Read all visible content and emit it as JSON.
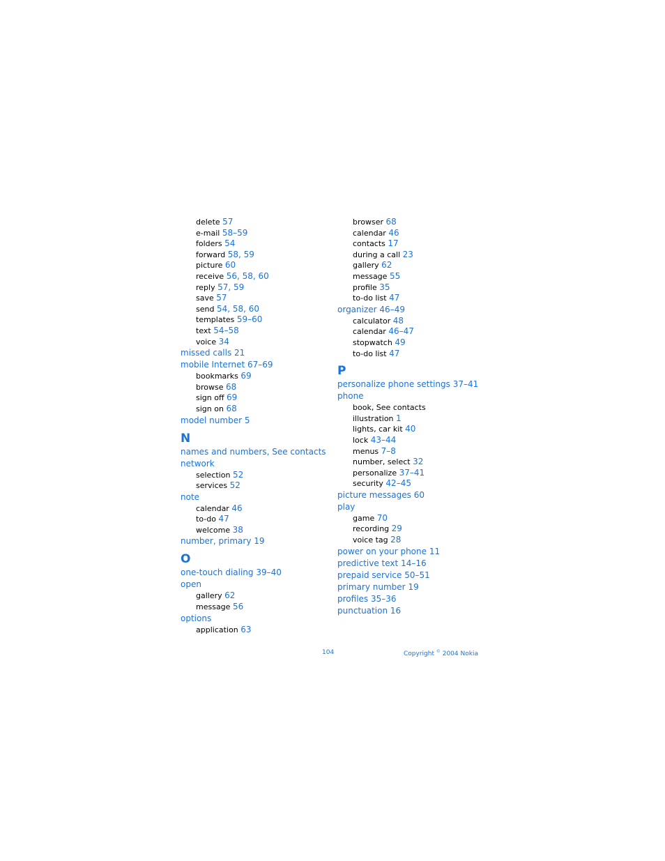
{
  "left_column": [
    {
      "type": "sub",
      "term": "delete",
      "pages": "57"
    },
    {
      "type": "sub",
      "term": "e-mail",
      "pages": "58–59"
    },
    {
      "type": "sub",
      "term": "folders",
      "pages": "54"
    },
    {
      "type": "sub",
      "term": "forward",
      "pages": "58, 59"
    },
    {
      "type": "sub",
      "term": "picture",
      "pages": "60"
    },
    {
      "type": "sub",
      "term": "receive",
      "pages": "56, 58, 60"
    },
    {
      "type": "sub",
      "term": "reply",
      "pages": "57, 59"
    },
    {
      "type": "sub",
      "term": "save",
      "pages": "57"
    },
    {
      "type": "sub",
      "term": "send",
      "pages": "54, 58, 60"
    },
    {
      "type": "sub",
      "term": "templates",
      "pages": "59–60"
    },
    {
      "type": "sub",
      "term": "text",
      "pages": "54–58"
    },
    {
      "type": "sub",
      "term": "voice",
      "pages": "34"
    },
    {
      "type": "main",
      "term": "missed calls",
      "pages": "21"
    },
    {
      "type": "main",
      "term": "mobile Internet",
      "pages": "67–69"
    },
    {
      "type": "sub",
      "term": "bookmarks",
      "pages": "69"
    },
    {
      "type": "sub",
      "term": "browse",
      "pages": "68"
    },
    {
      "type": "sub",
      "term": "sign off",
      "pages": "69"
    },
    {
      "type": "sub",
      "term": "sign on",
      "pages": "68"
    },
    {
      "type": "main",
      "term": "model number",
      "pages": "5"
    },
    {
      "type": "letter",
      "term": "N"
    },
    {
      "type": "main",
      "term": "names and numbers, See contacts",
      "pages": ""
    },
    {
      "type": "main",
      "term": "network",
      "pages": ""
    },
    {
      "type": "sub",
      "term": "selection",
      "pages": "52"
    },
    {
      "type": "sub",
      "term": "services",
      "pages": "52"
    },
    {
      "type": "main",
      "term": "note",
      "pages": ""
    },
    {
      "type": "sub",
      "term": "calendar",
      "pages": "46"
    },
    {
      "type": "sub",
      "term": "to-do",
      "pages": "47"
    },
    {
      "type": "sub",
      "term": "welcome",
      "pages": "38"
    },
    {
      "type": "main",
      "term": "number, primary",
      "pages": "19"
    },
    {
      "type": "letter",
      "term": "O"
    },
    {
      "type": "main",
      "term": "one-touch dialing",
      "pages": "39–40"
    },
    {
      "type": "main",
      "term": "open",
      "pages": ""
    },
    {
      "type": "sub",
      "term": "gallery",
      "pages": "62"
    },
    {
      "type": "sub",
      "term": "message",
      "pages": "56"
    },
    {
      "type": "main",
      "term": "options",
      "pages": ""
    },
    {
      "type": "sub",
      "term": "application",
      "pages": "63"
    }
  ],
  "right_column": [
    {
      "type": "sub",
      "term": "browser",
      "pages": "68"
    },
    {
      "type": "sub",
      "term": "calendar",
      "pages": "46"
    },
    {
      "type": "sub",
      "term": "contacts",
      "pages": "17"
    },
    {
      "type": "sub",
      "term": "during a call",
      "pages": "23"
    },
    {
      "type": "sub",
      "term": "gallery",
      "pages": "62"
    },
    {
      "type": "sub",
      "term": "message",
      "pages": "55"
    },
    {
      "type": "sub",
      "term": "profile",
      "pages": "35"
    },
    {
      "type": "sub",
      "term": "to-do list",
      "pages": "47"
    },
    {
      "type": "main",
      "term": "organizer",
      "pages": "46–49"
    },
    {
      "type": "sub",
      "term": "calculator",
      "pages": "48"
    },
    {
      "type": "sub",
      "term": "calendar",
      "pages": "46–47"
    },
    {
      "type": "sub",
      "term": "stopwatch",
      "pages": "49"
    },
    {
      "type": "sub",
      "term": "to-do list",
      "pages": "47"
    },
    {
      "type": "letter",
      "term": "P"
    },
    {
      "type": "main",
      "term": "personalize phone settings",
      "pages": "37–41"
    },
    {
      "type": "main",
      "term": "phone",
      "pages": ""
    },
    {
      "type": "sub",
      "term": "book, See contacts",
      "pages": ""
    },
    {
      "type": "sub",
      "term": "illustration",
      "pages": "1"
    },
    {
      "type": "sub",
      "term": "lights, car kit",
      "pages": "40"
    },
    {
      "type": "sub",
      "term": "lock",
      "pages": "43–44"
    },
    {
      "type": "sub",
      "term": "menus",
      "pages": "7–8"
    },
    {
      "type": "sub",
      "term": "number, select",
      "pages": "32"
    },
    {
      "type": "sub",
      "term": "personalize",
      "pages": "37–41"
    },
    {
      "type": "sub",
      "term": "security",
      "pages": "42–45"
    },
    {
      "type": "main",
      "term": "picture messages",
      "pages": "60"
    },
    {
      "type": "main",
      "term": "play",
      "pages": ""
    },
    {
      "type": "sub",
      "term": "game",
      "pages": "70"
    },
    {
      "type": "sub",
      "term": "recording",
      "pages": "29"
    },
    {
      "type": "sub",
      "term": "voice tag",
      "pages": "28"
    },
    {
      "type": "main",
      "term": "power on your phone",
      "pages": "11"
    },
    {
      "type": "main",
      "term": "predictive text",
      "pages": "14–16"
    },
    {
      "type": "main",
      "term": "prepaid service",
      "pages": "50–51"
    },
    {
      "type": "main",
      "term": "primary number",
      "pages": "19"
    },
    {
      "type": "main",
      "term": "profiles",
      "pages": "35–36"
    },
    {
      "type": "main",
      "term": "punctuation",
      "pages": "16"
    }
  ],
  "footer": {
    "page_number": "104",
    "copyright_prefix": "Copyright",
    "copyright_symbol": "©",
    "copyright_suffix": "2004 Nokia"
  },
  "colors": {
    "link_blue": "#1a73d9",
    "text_black": "#000000"
  }
}
